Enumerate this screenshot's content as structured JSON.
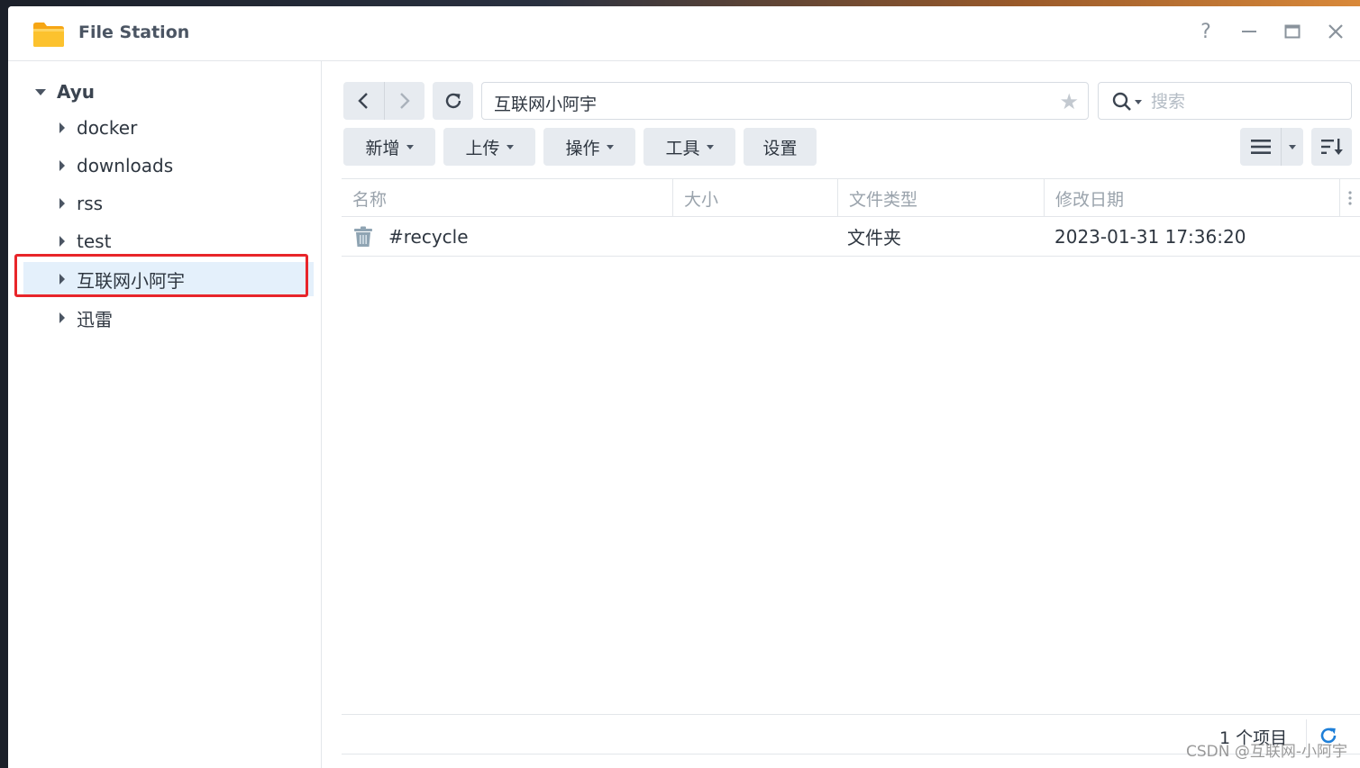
{
  "window": {
    "title": "File Station"
  },
  "title_controls": {
    "help": "?",
    "minimize": "—",
    "maximize": "□",
    "close": "✕"
  },
  "sidebar": {
    "root": "Ayu",
    "items": [
      {
        "label": "docker"
      },
      {
        "label": "downloads"
      },
      {
        "label": "rss"
      },
      {
        "label": "test"
      },
      {
        "label": "互联网小阿宇"
      },
      {
        "label": "迅雷"
      }
    ],
    "selected_index": 4
  },
  "toolbar": {
    "path": "互联网小阿宇",
    "search_placeholder": "搜索",
    "buttons": {
      "new": "新增",
      "upload": "上传",
      "action": "操作",
      "tools": "工具",
      "settings": "设置"
    }
  },
  "grid": {
    "columns": [
      "名称",
      "大小",
      "文件类型",
      "修改日期"
    ],
    "rows": [
      {
        "name": "#recycle",
        "size": "",
        "type": "文件夹",
        "modified": "2023-01-31 17:36:20",
        "icon": "trash-icon"
      }
    ]
  },
  "footer": {
    "item_count": "1 个项目"
  },
  "watermark": "CSDN @互联网-小阿宇",
  "colors": {
    "accent": "#1e7fd8",
    "highlight": "#e8252a",
    "selected_bg": "#e4f0fb"
  }
}
